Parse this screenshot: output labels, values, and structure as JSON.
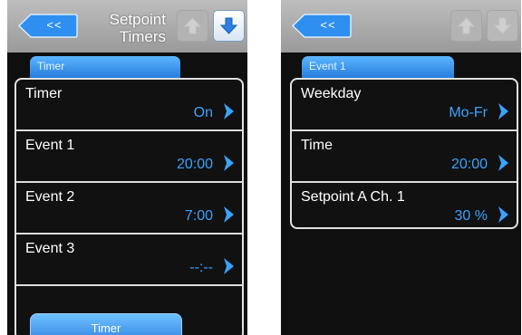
{
  "left": {
    "back_label": "<<",
    "title_line1": "Setpoint",
    "title_line2": "Timers",
    "tab_label": "Timer",
    "items": [
      {
        "label": "Timer",
        "value": "On"
      },
      {
        "label": "Event 1",
        "value": "20:00"
      },
      {
        "label": "Event 2",
        "value": "7:00"
      },
      {
        "label": "Event 3",
        "value": "--:--"
      }
    ],
    "bottom_button": "Timer"
  },
  "right": {
    "back_label": "<<",
    "tab_label": "Event 1",
    "items": [
      {
        "label": "Weekday",
        "value": "Mo-Fr"
      },
      {
        "label": "Time",
        "value": "20:00"
      },
      {
        "label": "Setpoint A Ch. 1",
        "value": "30 %"
      }
    ]
  },
  "colors": {
    "accent_blue": "#3aa3ff",
    "header_gray": "#a8a8a8",
    "panel_bg": "#111111"
  },
  "icons": {
    "back": "double-chevron-left-icon",
    "up": "up-arrow-icon",
    "down": "down-arrow-icon",
    "row": "chevron-right-icon"
  }
}
